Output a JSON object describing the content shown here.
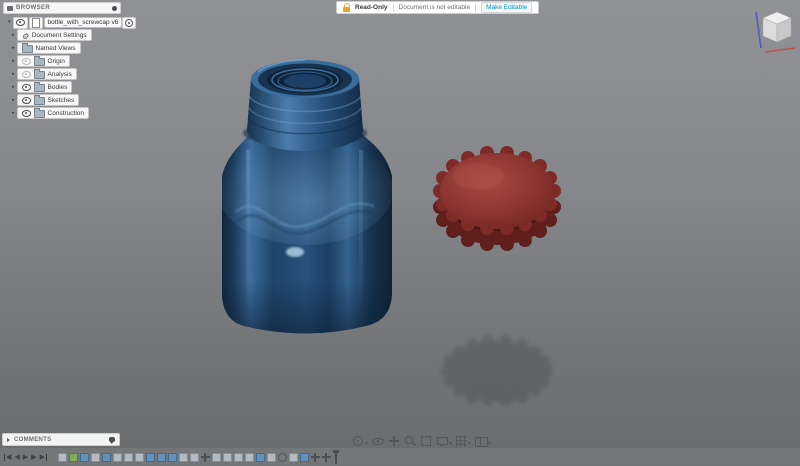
{
  "browser": {
    "title": "BROWSER",
    "document": {
      "name": "bottle_with_screwcap v6"
    },
    "items": [
      {
        "label": "Document Settings",
        "gear": true
      },
      {
        "label": "Named Views",
        "folder": true
      },
      {
        "label": "Origin",
        "folder": true,
        "eye": true,
        "dim": "dim"
      },
      {
        "label": "Analysis",
        "folder": true,
        "eye": true,
        "dim": "dim"
      },
      {
        "label": "Bodies",
        "folder": true,
        "eye": true
      },
      {
        "label": "Sketches",
        "folder": true,
        "eye": true
      },
      {
        "label": "Construction",
        "folder": true,
        "eye": true
      }
    ]
  },
  "banner": {
    "badge": "Read-Only",
    "message": "Document is not editable",
    "action": "Make Editable",
    "lock_color": "#eda62c",
    "action_color": "#0696d7"
  },
  "comments": {
    "title": "COMMENTS"
  },
  "navbar": {
    "items": [
      {
        "name": "orbit",
        "caret": true
      },
      {
        "name": "lookat"
      },
      {
        "name": "pan"
      },
      {
        "name": "zoom"
      },
      {
        "name": "fit"
      },
      {
        "name": "display",
        "caret": true
      },
      {
        "name": "grid",
        "caret": true
      },
      {
        "name": "viewports",
        "caret": true
      }
    ]
  },
  "timeline": {
    "playback": [
      {
        "glyph": "◀",
        "bar": "barleft"
      },
      {
        "glyph": "◀"
      },
      {
        "glyph": "▶"
      },
      {
        "glyph": "▶"
      },
      {
        "glyph": "▶",
        "bar": "barright"
      }
    ],
    "features": [
      {
        "type": "fillet"
      },
      {
        "type": "sketch"
      },
      {
        "type": "extrude"
      },
      {
        "type": "fillet"
      },
      {
        "type": "extrude"
      },
      {
        "type": "fillet"
      },
      {
        "type": "fillet"
      },
      {
        "type": "fillet"
      },
      {
        "type": "extrude"
      },
      {
        "type": "extrude"
      },
      {
        "type": "extrude"
      },
      {
        "type": "fillet"
      },
      {
        "type": "fillet"
      },
      {
        "type": "move"
      },
      {
        "type": "fillet"
      },
      {
        "type": "fillet"
      },
      {
        "type": "fillet"
      },
      {
        "type": "fillet"
      },
      {
        "type": "extrude"
      },
      {
        "type": "fillet"
      },
      {
        "type": "hole"
      },
      {
        "type": "fillet"
      },
      {
        "type": "extrude"
      },
      {
        "type": "move"
      },
      {
        "type": "move"
      }
    ]
  },
  "scene": {
    "bottle_color": "#1d4066",
    "cap_color": "#7e2b28",
    "shadow_color": "#4e5052",
    "canvas_top_color": "#909295",
    "canvas_bottom_color": "#696b6d",
    "viewcube_axis_z_color": "#5058c8",
    "viewcube_axis_x_color": "#c05050"
  }
}
